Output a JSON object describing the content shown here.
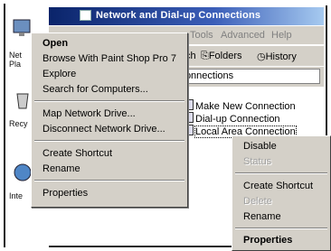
{
  "window": {
    "title": "Network and Dial-up Connections",
    "icon": "network-folder-icon",
    "menubar": [
      "Tools",
      "Advanced",
      "Help"
    ],
    "toolbar": {
      "search_partial": "ch",
      "folders_label": "Folders",
      "history_label": "History"
    },
    "address_value": "Connections"
  },
  "desktop": {
    "labels": {
      "network_partial": "Net",
      "places_partial": "Pla",
      "recycle_partial": "Recy",
      "internet_partial": "Inte"
    }
  },
  "connections": [
    {
      "label": "Make New Connection",
      "icon": "make-connection-icon"
    },
    {
      "label": "Dial-up Connection",
      "icon": "dialup-icon"
    },
    {
      "label": "Local Area Connection",
      "icon": "lan-icon"
    }
  ],
  "context_menu_desktop": {
    "items": {
      "open": "Open",
      "browse_psp": "Browse With Paint Shop Pro 7",
      "explore": "Explore",
      "search_computers": "Search for Computers...",
      "map_drive": "Map Network Drive...",
      "disconnect_drive": "Disconnect Network Drive...",
      "create_shortcut": "Create Shortcut",
      "rename": "Rename",
      "properties": "Properties"
    }
  },
  "context_menu_connection": {
    "items": {
      "disable": "Disable",
      "status": "Status",
      "create_shortcut": "Create Shortcut",
      "delete": "Delete",
      "rename": "Rename",
      "properties": "Properties"
    }
  }
}
